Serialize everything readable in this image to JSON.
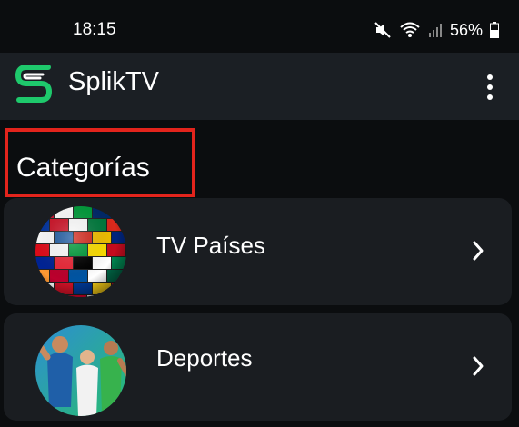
{
  "status_bar": {
    "time": "18:15",
    "battery": "56%"
  },
  "app_bar": {
    "title": "SplikTV",
    "logo_color": "#1ec96c"
  },
  "highlight_color": "#e3241c",
  "section": {
    "title": "Categorías"
  },
  "categories": [
    {
      "label": "TV Países",
      "icon": "world-flags-globe"
    },
    {
      "label": "Deportes",
      "icon": "sports-athletes"
    }
  ]
}
